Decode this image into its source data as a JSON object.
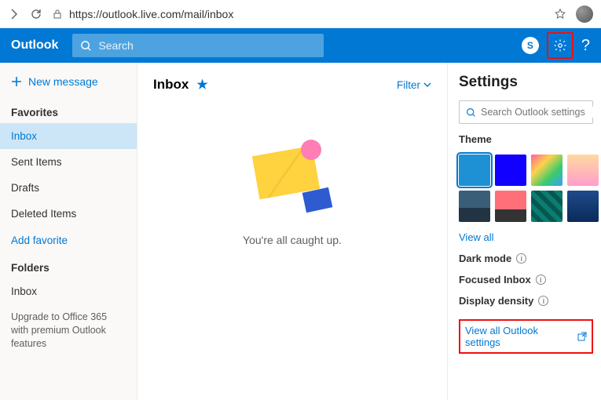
{
  "browser": {
    "url": "https://outlook.live.com/mail/inbox"
  },
  "header": {
    "brand": "Outlook",
    "search_placeholder": "Search",
    "skype_badge": "S",
    "help": "?"
  },
  "sidebar": {
    "new_message": "New message",
    "favorites_label": "Favorites",
    "favorites": [
      {
        "label": "Inbox",
        "active": true
      },
      {
        "label": "Sent Items",
        "active": false
      },
      {
        "label": "Drafts",
        "active": false
      },
      {
        "label": "Deleted Items",
        "active": false
      }
    ],
    "add_favorite": "Add favorite",
    "folders_label": "Folders",
    "folders": [
      {
        "label": "Inbox"
      }
    ],
    "upgrade": "Upgrade to Office 365 with premium Outlook features"
  },
  "mail": {
    "inbox_title": "Inbox",
    "filter_label": "Filter",
    "empty_text": "You're all caught up."
  },
  "settings": {
    "title": "Settings",
    "search_placeholder": "Search Outlook settings",
    "theme_label": "Theme",
    "themes": [
      {
        "bg": "#1e90d4",
        "selected": true
      },
      {
        "bg": "#1100ff"
      },
      {
        "bg": "linear-gradient(135deg,#ff5ea0,#ffd24a,#3acb6b,#39a0ff)"
      },
      {
        "bg": "linear-gradient(180deg,#ffd9a0,#ff9ecb)"
      },
      {
        "bg": "linear-gradient(180deg,#3a5e78 55%,#223344 55%)"
      },
      {
        "bg": "linear-gradient(180deg,#ff6f7a 60%,#333 60%)"
      },
      {
        "bg": "repeating-linear-gradient(45deg,#0b7d72 0 6px,#06584f 6px 12px)"
      },
      {
        "bg": "linear-gradient(180deg,#1e4b8c,#0b2a5a)"
      }
    ],
    "view_all_themes": "View all",
    "dark_mode_label": "Dark mode",
    "focused_inbox_label": "Focused Inbox",
    "display_density_label": "Display density",
    "view_all_settings": "View all Outlook settings"
  }
}
